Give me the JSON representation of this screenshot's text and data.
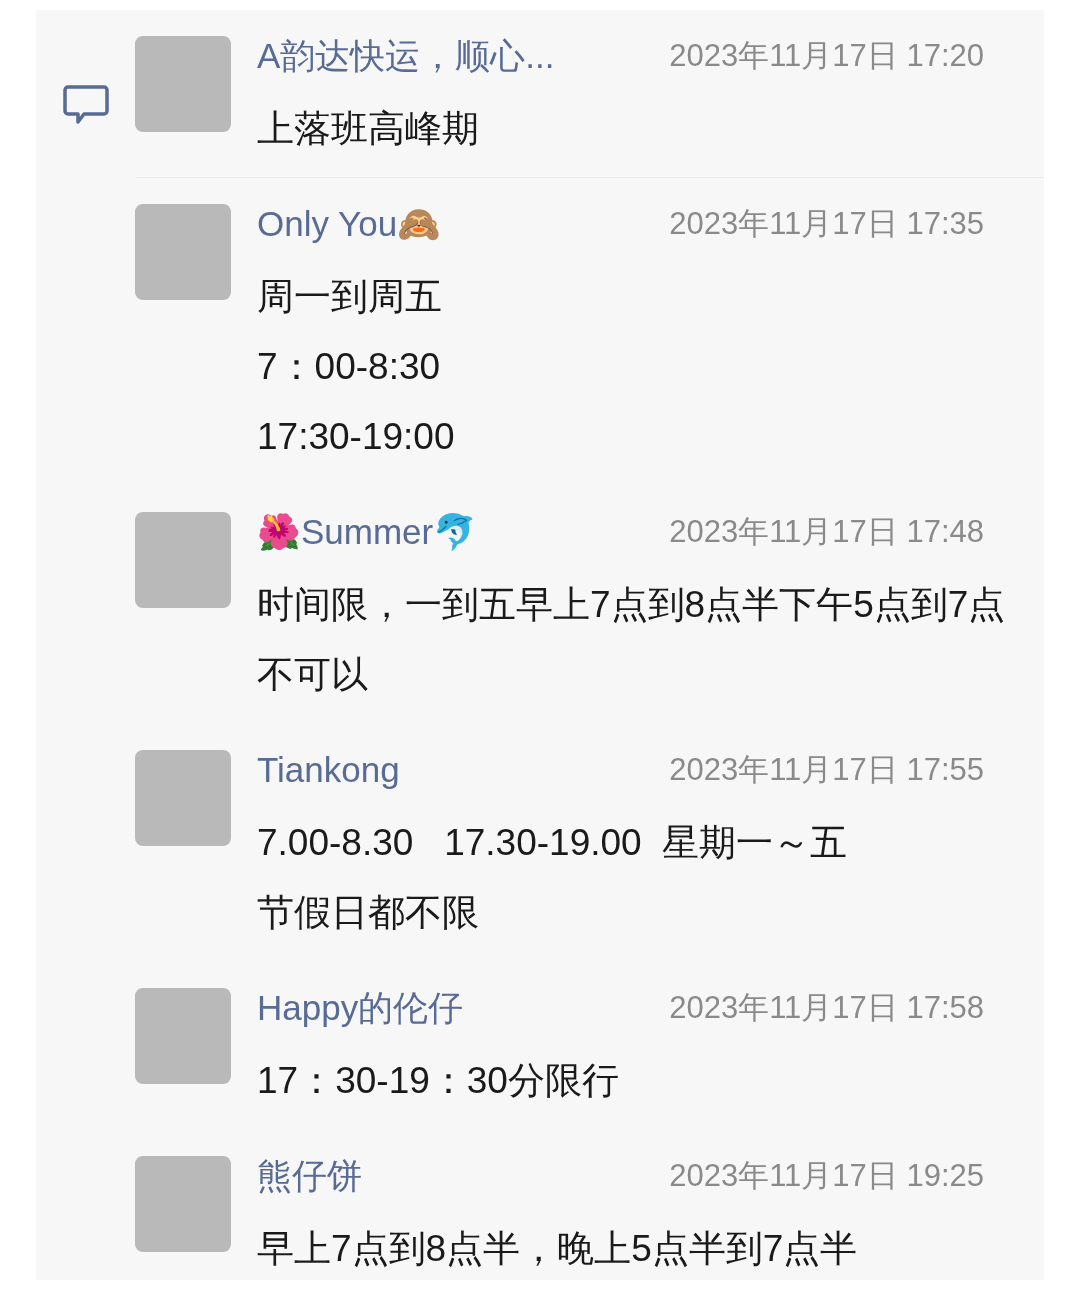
{
  "comments": [
    {
      "name": "A韵达快运，顺心...",
      "time": "2023年11月17日 17:20",
      "lines": [
        "上落班高峰期"
      ]
    },
    {
      "name": "Only You🙈",
      "time": "2023年11月17日 17:35",
      "lines": [
        "周一到周五",
        "7：00-8:30",
        "17:30-19:00"
      ]
    },
    {
      "name": "🌺Summer🐬",
      "time": "2023年11月17日 17:48",
      "lines": [
        "时间限，一到五早上7点到8点半下午5点到7点不可以"
      ]
    },
    {
      "name": "Tiankong",
      "time": "2023年11月17日 17:55",
      "lines": [
        "7.00-8.30   17.30-19.00  星期一～五",
        "节假日都不限"
      ]
    },
    {
      "name": "Happy的伦仔",
      "time": "2023年11月17日 17:58",
      "lines": [
        "17：30-19：30分限行"
      ]
    },
    {
      "name": "熊仔饼",
      "time": "2023年11月17日 19:25",
      "lines": [
        "早上7点到8点半，晚上5点半到7点半"
      ]
    }
  ]
}
